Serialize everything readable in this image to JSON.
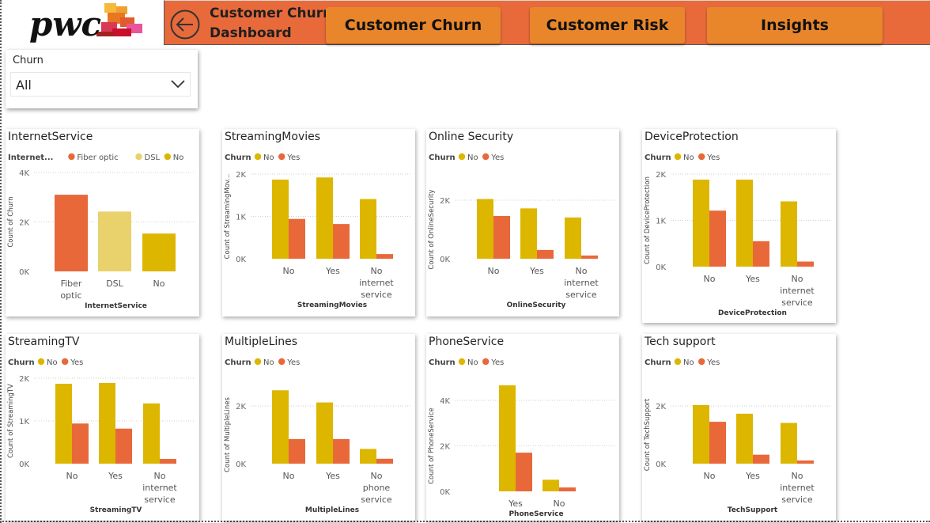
{
  "header": {
    "logo_text": "pwc",
    "title_line1": "Customer Churn",
    "title_line2": "Dashboard",
    "nav": [
      "Customer Churn",
      "Customer Risk",
      "Insights"
    ]
  },
  "slicer": {
    "label": "Churn",
    "value": "All"
  },
  "colors": {
    "yes": "#E8683A",
    "no": "#DDB600",
    "dsl": "#E9D16C",
    "header": "#E86A3B",
    "nav": "#E9862B"
  },
  "charts": [
    {
      "title": "InternetService",
      "legend_title": "Internet...",
      "legend": [
        "Fiber optic",
        "DSL",
        "No"
      ],
      "legend_colors": [
        "yes",
        "dsl",
        "no"
      ],
      "y_label": "Count of Churn",
      "x_label": "InternetService",
      "y_ticks": [
        "4K",
        "2K",
        "0K"
      ],
      "chart_data": {
        "type": "bar",
        "categories": [
          [
            "Fiber",
            "optic"
          ],
          [
            "DSL"
          ],
          [
            "No"
          ]
        ],
        "series": [
          {
            "values": [
              3100,
              2420,
              1530
            ]
          }
        ],
        "ylim": [
          0,
          4000
        ]
      }
    },
    {
      "title": "StreamingMovies",
      "legend_title": "Churn",
      "legend": [
        "No",
        "Yes"
      ],
      "legend_colors": [
        "no",
        "yes"
      ],
      "y_label": "Count of StreamingMov...",
      "x_label": "StreamingMovies",
      "y_ticks": [
        "2K",
        "1K",
        "0K"
      ],
      "chart_data": {
        "type": "bar",
        "categories": [
          [
            "No"
          ],
          [
            "Yes"
          ],
          [
            "No",
            "internet",
            "service"
          ]
        ],
        "series": [
          {
            "name": "No",
            "values": [
              1870,
              1920,
              1410
            ]
          },
          {
            "name": "Yes",
            "values": [
              940,
              820,
              110
            ]
          }
        ],
        "ylim": [
          0,
          2000
        ]
      }
    },
    {
      "title": "Online Security",
      "legend_title": "Churn",
      "legend": [
        "No",
        "Yes"
      ],
      "legend_colors": [
        "no",
        "yes"
      ],
      "y_label": "Count of OnlineSecurity",
      "x_label": "OnlineSecurity",
      "y_ticks": [
        "2K",
        "0K"
      ],
      "chart_data": {
        "type": "bar",
        "categories": [
          [
            "No"
          ],
          [
            "Yes"
          ],
          [
            "No",
            "internet",
            "service"
          ]
        ],
        "series": [
          {
            "name": "No",
            "values": [
              2040,
              1720,
              1410
            ]
          },
          {
            "name": "Yes",
            "values": [
              1460,
              300,
              110
            ]
          }
        ],
        "ylim": [
          0,
          2000
        ]
      }
    },
    {
      "title": "DeviceProtection",
      "legend_title": "Churn",
      "legend": [
        "No",
        "Yes"
      ],
      "legend_colors": [
        "no",
        "yes"
      ],
      "y_label": "Count of DeviceProtection",
      "x_label": "DeviceProtection",
      "y_ticks": [
        "2K",
        "1K",
        "0K"
      ],
      "chart_data": {
        "type": "bar",
        "categories": [
          [
            "No"
          ],
          [
            "Yes"
          ],
          [
            "No",
            "internet",
            "service"
          ]
        ],
        "series": [
          {
            "name": "No",
            "values": [
              1880,
              1880,
              1410
            ]
          },
          {
            "name": "Yes",
            "values": [
              1210,
              550,
              110
            ]
          }
        ],
        "ylim": [
          0,
          2000
        ]
      }
    },
    {
      "title": "StreamingTV",
      "legend_title": "Churn",
      "legend": [
        "No",
        "Yes"
      ],
      "legend_colors": [
        "no",
        "yes"
      ],
      "y_label": "Count of StreamingTV",
      "x_label": "StreamingTV",
      "y_ticks": [
        "2K",
        "1K",
        "0K"
      ],
      "chart_data": {
        "type": "bar",
        "categories": [
          [
            "No"
          ],
          [
            "Yes"
          ],
          [
            "No",
            "internet",
            "service"
          ]
        ],
        "series": [
          {
            "name": "No",
            "values": [
              1870,
              1890,
              1410
            ]
          },
          {
            "name": "Yes",
            "values": [
              940,
              820,
              110
            ]
          }
        ],
        "ylim": [
          0,
          2000
        ]
      }
    },
    {
      "title": "MultipleLines",
      "legend_title": "Churn",
      "legend": [
        "No",
        "Yes"
      ],
      "legend_colors": [
        "no",
        "yes"
      ],
      "y_label": "Count of MultipleLines",
      "x_label": "MultipleLines",
      "y_ticks": [
        "2K",
        "0K"
      ],
      "chart_data": {
        "type": "bar",
        "categories": [
          [
            "No"
          ],
          [
            "Yes"
          ],
          [
            "No",
            "phone",
            "service"
          ]
        ],
        "series": [
          {
            "name": "No",
            "values": [
              2540,
              2120,
              510
            ]
          },
          {
            "name": "Yes",
            "values": [
              850,
              850,
              170
            ]
          }
        ],
        "ylim": [
          0,
          2000
        ]
      }
    },
    {
      "title": "PhoneService",
      "legend_title": "Churn",
      "legend": [
        "No",
        "Yes"
      ],
      "legend_colors": [
        "no",
        "yes"
      ],
      "y_label": "Count of PhoneService",
      "x_label": "PhoneService",
      "y_ticks": [
        "4K",
        "2K",
        "0K"
      ],
      "chart_data": {
        "type": "bar",
        "categories": [
          [
            "Yes"
          ],
          [
            "No"
          ]
        ],
        "series": [
          {
            "name": "No",
            "values": [
              4660,
              510
            ]
          },
          {
            "name": "Yes",
            "values": [
              1700,
              170
            ]
          }
        ],
        "ylim": [
          0,
          4000
        ]
      }
    },
    {
      "title": "Tech support",
      "legend_title": "Churn",
      "legend": [
        "No",
        "Yes"
      ],
      "legend_colors": [
        "no",
        "yes"
      ],
      "y_label": "Count of TechSupport",
      "x_label": "TechSupport",
      "y_ticks": [
        "2K",
        "0K"
      ],
      "chart_data": {
        "type": "bar",
        "categories": [
          [
            "No"
          ],
          [
            "Yes"
          ],
          [
            "No",
            "internet",
            "service"
          ]
        ],
        "series": [
          {
            "name": "No",
            "values": [
              2030,
              1730,
              1410
            ]
          },
          {
            "name": "Yes",
            "values": [
              1450,
              310,
              110
            ]
          }
        ],
        "ylim": [
          0,
          2000
        ]
      }
    }
  ]
}
